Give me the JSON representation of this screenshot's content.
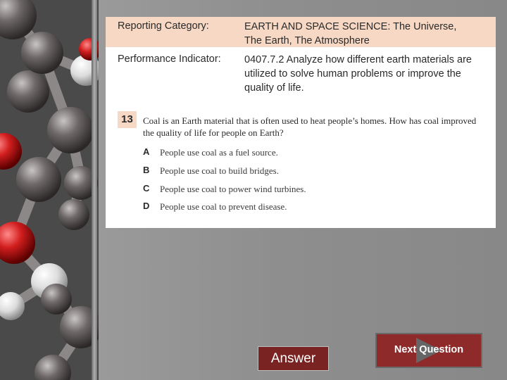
{
  "reporting": {
    "label": "Reporting Category:",
    "value_line1": "EARTH AND SPACE SCIENCE: The Universe,",
    "value_line2": "The Earth, The Atmosphere"
  },
  "performance": {
    "label": "Performance Indicator:",
    "value": "0407.7.2 Analyze how different earth materials are utilized to solve human problems or improve the quality of life."
  },
  "question": {
    "number": "13",
    "text": "Coal is an Earth material that is often used to heat people’s homes. How has coal improved the quality of life for people on Earth?",
    "choices": [
      {
        "letter": "A",
        "text": "People use coal as a fuel source."
      },
      {
        "letter": "B",
        "text": "People use coal to build bridges."
      },
      {
        "letter": "C",
        "text": "People use coal to power wind turbines."
      },
      {
        "letter": "D",
        "text": "People use coal to prevent disease."
      }
    ]
  },
  "buttons": {
    "answer_label": "Answer",
    "next_label": "Next Question"
  },
  "colors": {
    "header_band": "#f6d8c4",
    "button_red": "#8e2a2a",
    "atom_red": "#d21e1e",
    "atom_white": "#f2f2f2",
    "atom_grey": "#6a6666"
  }
}
